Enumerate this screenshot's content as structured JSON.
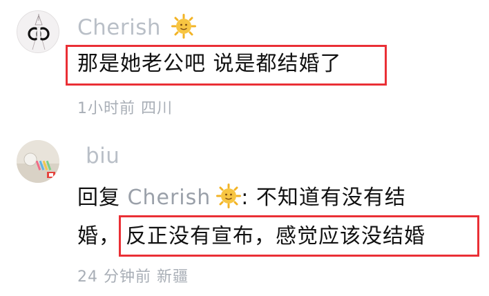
{
  "comments": [
    {
      "username": "Cherish",
      "avatar_icon": "chanel-logo-icon",
      "badge_icon": "sun-emoji-icon",
      "text": "那是她老公吧 说是都结婚了",
      "time": "1小时前",
      "location": "四川",
      "highlight_color": "#ea2f35"
    },
    {
      "username": "biu",
      "avatar_icon": "room-photo-icon",
      "reply_prefix": "回复",
      "reply_to": "Cherish",
      "reply_badge_icon": "sun-emoji-icon",
      "text_part1": ": 不知道有没有结",
      "text_part2": "婚，",
      "text_highlight": "反正没有宣布，感觉应该没结婚",
      "time": "24 分钟前",
      "location": "新疆",
      "highlight_color": "#ea2f35"
    }
  ]
}
